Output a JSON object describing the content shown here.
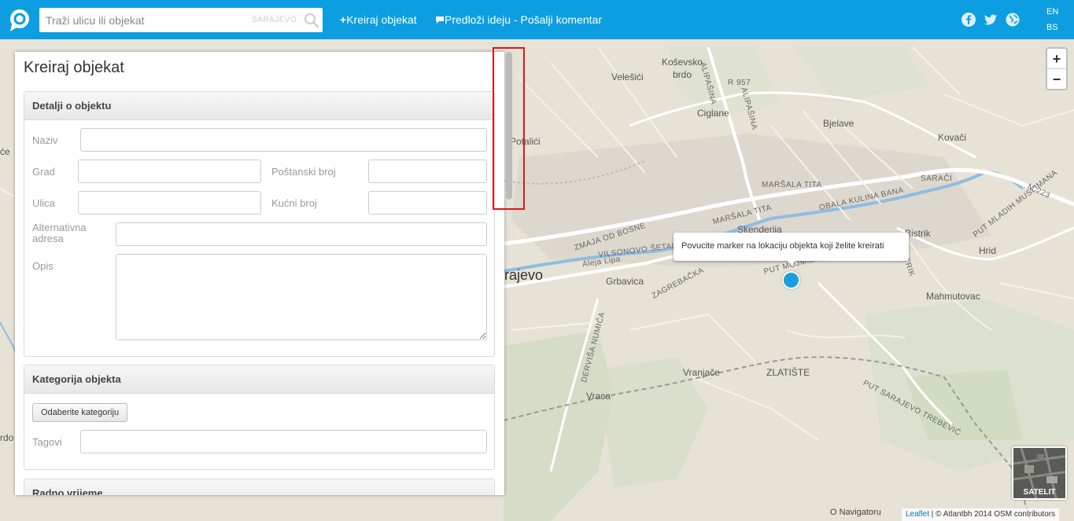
{
  "header": {
    "search_placeholder": "Traži ulicu ili objekat",
    "search_city": "SARAJEVO",
    "nav_create": "Kreiraj objekat",
    "nav_suggest": "Predloži ideju - Pošalji komentar",
    "lang_en": "EN",
    "lang_bs": "BS",
    "brand_color": "#0c9ee1"
  },
  "panel": {
    "title": "Kreiraj objekat",
    "details": {
      "heading": "Detalji o objektu",
      "naziv_label": "Naziv",
      "grad_label": "Grad",
      "postanski_label": "Poštanski broj",
      "ulica_label": "Ulica",
      "kucni_label": "Kućni broj",
      "alt_label_1": "Alternativna",
      "alt_label_2": "adresa",
      "opis_label": "Opis"
    },
    "category": {
      "heading": "Kategorija objekta",
      "button": "Odaberite kategoriju",
      "tags_label": "Tagovi"
    },
    "hours": {
      "heading": "Radno vrijeme"
    }
  },
  "map": {
    "tooltip": "Povucite marker na lokaciju objekta koji želite kreirati",
    "zoom_in": "+",
    "zoom_out": "−",
    "satellite_label": "SATELIT",
    "navigatoru": "O Navigatoru",
    "attribution_leaflet": "Leaflet",
    "attribution_rest": " | © Atlantbh 2014 OSM contributors",
    "labels": {
      "kosevsko": "Koševsko",
      "brdo": "brdo",
      "velesici": "Velešići",
      "alipasina1": "ALIPAŠINA",
      "alipasina2": "ALIPAŠINA",
      "r957": "R 957",
      "ciglane": "Ciglane",
      "bjelave": "Bjelave",
      "kovaci": "Kovači",
      "potalici": "Potalići",
      "marsala1": "MARŠALA TITA",
      "marsala2": "MARŠALA TITA",
      "saraci": "SARAČI",
      "m223": "M 223",
      "obala": "OBALA KULINA BANA",
      "mladih": "PUT MLADIH MUSLIMANA",
      "zmaja": "ZMAJA OD BOSNE",
      "skenderija": "Skenderija",
      "bistrik1": "Bistrik",
      "bistrik2": "BISTRIK",
      "hrid": "Hrid",
      "vilsonovo": "VILSONOVO ŠETALIŠTE",
      "aleja": "Aleja Lipa",
      "sarajevo": "rajevo",
      "grbavica": "Grbavica",
      "zagrebacka": "ZAGREBAČKA",
      "mahmutovac": "Mahmutovac",
      "put_mojmilo": "PUT MOJMILA",
      "vranjace": "Vranjače",
      "zlatiste": "ZLATIŠTE",
      "dervisa": "DERVIŠA NUMIĆA",
      "trebevic": "PUT SARAJEVO TREBEVIĆ",
      "vraca": "Vraca",
      "left_sce": "će",
      "left_rdo": "rdo"
    }
  }
}
